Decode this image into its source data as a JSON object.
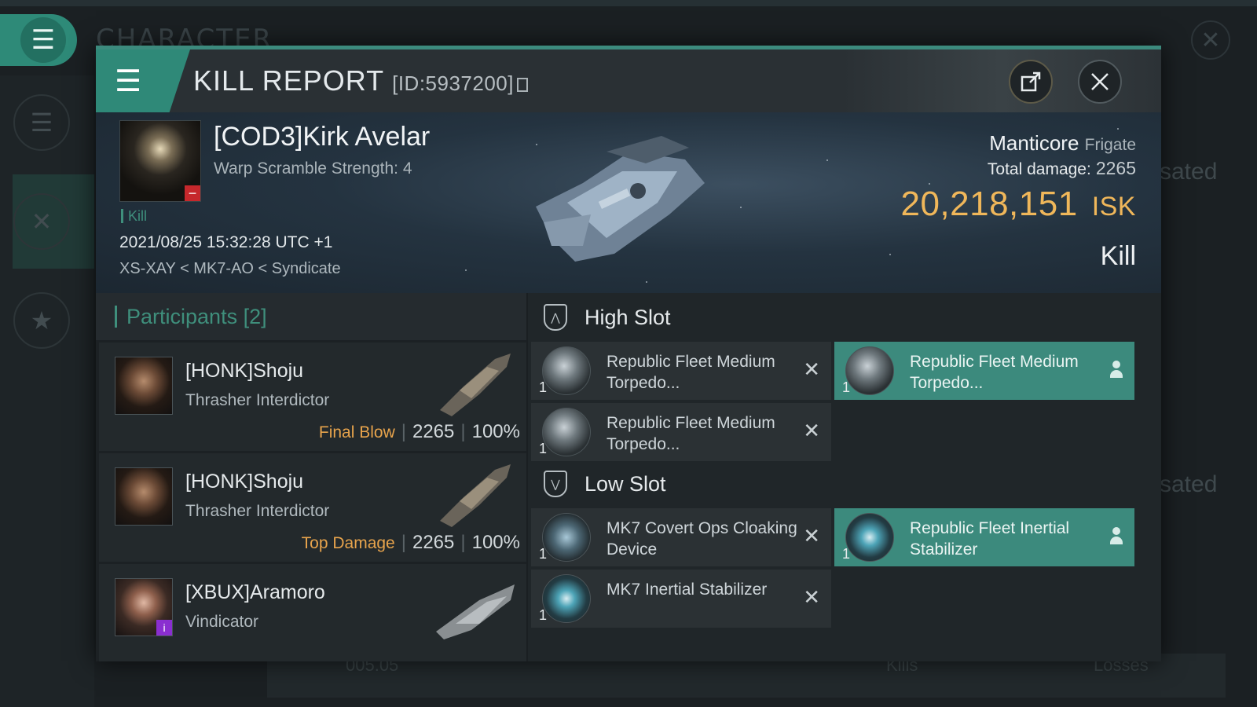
{
  "background": {
    "page_title": "CHARACTER",
    "right_text_1": "sated",
    "right_text_2": "sated",
    "bottom_value": "005.05",
    "bottom_kills": "Kills",
    "bottom_losses": "Losses"
  },
  "modal": {
    "title": "KILL REPORT",
    "id_label": "[ID:5937200]"
  },
  "victim": {
    "name": "[COD3]Kirk Avelar",
    "subtitle": "Warp Scramble Strength: 4",
    "tag": "Kill",
    "timestamp": "2021/08/25 15:32:28 UTC +1",
    "location": "XS-XAY < MK7-AO < Syndicate",
    "ship_name": "Manticore",
    "ship_class": "Frigate",
    "total_damage_label": "Total damage:",
    "total_damage": "2265",
    "isk_value": "20,218,151",
    "isk_unit": "ISK",
    "result": "Kill"
  },
  "participants": {
    "header": "Participants [2]",
    "rows": [
      {
        "name": "[HONK]Shoju",
        "ship": "Thrasher Interdictor",
        "role": "Final Blow",
        "damage": "2265",
        "percent": "100%"
      },
      {
        "name": "[HONK]Shoju",
        "ship": "Thrasher Interdictor",
        "role": "Top Damage",
        "damage": "2265",
        "percent": "100%"
      },
      {
        "name": "[XBUX]Aramoro",
        "ship": "Vindicator",
        "role": "",
        "damage": "",
        "percent": ""
      }
    ]
  },
  "slots": {
    "high": {
      "label": "High Slot",
      "items": [
        {
          "name": "Republic Fleet Medium Torpedo...",
          "qty": "1",
          "status": "destroyed"
        },
        {
          "name": "Republic Fleet Medium Torpedo...",
          "qty": "1",
          "status": "dropped"
        },
        {
          "name": "Republic Fleet Medium Torpedo...",
          "qty": "1",
          "status": "destroyed"
        }
      ]
    },
    "low": {
      "label": "Low Slot",
      "items": [
        {
          "name": "MK7 Covert Ops Cloaking Device",
          "qty": "1",
          "status": "destroyed"
        },
        {
          "name": "Republic Fleet Inertial Stabilizer",
          "qty": "1",
          "status": "dropped"
        },
        {
          "name": "MK7 Inertial Stabilizer",
          "qty": "1",
          "status": "destroyed"
        }
      ]
    }
  },
  "colors": {
    "accent": "#3c8a7d",
    "isk": "#f0b75a",
    "role": "#e8a44c",
    "destroyed_bg": "#2b3134",
    "dropped_bg": "#3c8a7d"
  },
  "icons": {
    "menu": "hamburger-icon",
    "share": "external-link-icon",
    "close": "close-icon",
    "copy": "copy-icon",
    "slot": "shield-icon",
    "destroyed": "x-icon",
    "dropped": "person-icon"
  }
}
